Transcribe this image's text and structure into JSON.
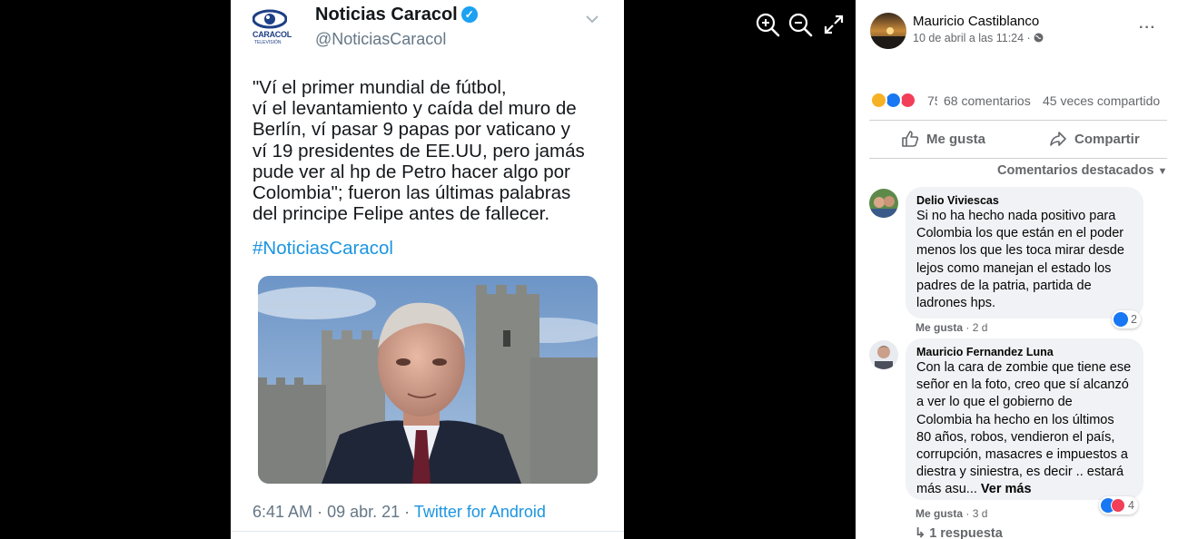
{
  "tweet": {
    "account_name": "Noticias Caracol",
    "handle": "@NoticiasCaracol",
    "logo_text": "CARACOL",
    "logo_subtext": "TELEVISIÓN",
    "text_lines": [
      "\"Ví el primer mundial de fútbol,",
      "ví el levantamiento y caída del muro de",
      "Berlín, ví pasar 9 papas por vaticano y",
      "ví 19 presidentes de EE.UU, pero jamás",
      "pude ver al hp de Petro hacer algo por",
      "Colombia\"; fueron las últimas palabras",
      "del principe Felipe antes de fallecer."
    ],
    "hashtag": "#NoticiasCaracol",
    "time": "6:41 AM",
    "date": "09 abr. 21",
    "source": "Twitter for Android",
    "separator": "·"
  },
  "post": {
    "author": "Mauricio Castiblanco",
    "date": "10 de abril a las 11:24 ·",
    "more": "···",
    "reaction_count": "75",
    "comments": "68 comentarios",
    "shares": "45 veces compartido",
    "like_label": "Me gusta",
    "share_label": "Compartir",
    "sort_label": "Comentarios destacados"
  },
  "comments": [
    {
      "author": "Delio Viviescas",
      "lines": [
        "Si no ha hecho nada positivo para",
        "Colombia los que están en el poder",
        "menos los que les toca mirar desde",
        "lejos como manejan el estado los",
        "padres de la patria, partida de",
        "ladrones hps."
      ],
      "like": "Me gusta",
      "time": "· 2 d",
      "reactions": "2"
    },
    {
      "author": "Mauricio Fernandez Luna",
      "lines": [
        "Con la cara de zombie que tiene ese",
        "señor en la foto, creo que sí alcanzó",
        "a ver lo que el gobierno de",
        "Colombia ha hecho en los últimos",
        "80 años, robos, vendieron el país,",
        "corrupción, masacres e impuestos a",
        "diestra y siniestra, es decir .. estará",
        "más asu..."
      ],
      "see_more": "Ver más",
      "like": "Me gusta",
      "time": "· 3 d",
      "reactions": "4",
      "replies": "1 respuesta"
    }
  ],
  "colors": {
    "twitter_blue": "#1b95e0",
    "fb_gray": "#65676b",
    "bubble": "#f0f2f5"
  }
}
